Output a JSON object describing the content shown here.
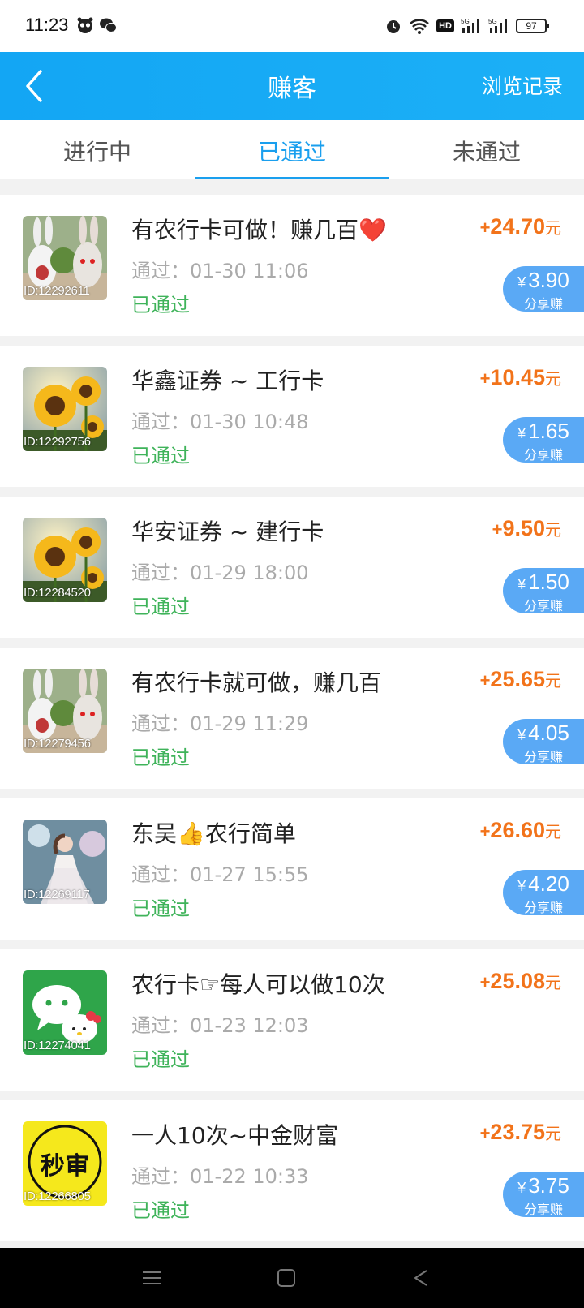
{
  "status_bar": {
    "time": "11:23",
    "hd": "HD",
    "battery": "97"
  },
  "header": {
    "title": "赚客",
    "right_action": "浏览记录"
  },
  "tabs": [
    {
      "label": "进行中"
    },
    {
      "label": "已通过",
      "active": true
    },
    {
      "label": "未通过"
    }
  ],
  "share_label": "分享赚",
  "yen": "¥",
  "items": [
    {
      "id": "ID:12292611",
      "title": "有农行卡可做！赚几百❤️",
      "time": "通过：01-30 11:06",
      "status": "已通过",
      "plus": "+",
      "amount": "24.70",
      "unit": "元",
      "share": "3.90",
      "thumb": "rabbit"
    },
    {
      "id": "ID:12292756",
      "title": "华鑫证券 ~ 工行卡",
      "time": "通过：01-30 10:48",
      "status": "已通过",
      "plus": "+",
      "amount": "10.45",
      "unit": "元",
      "share": "1.65",
      "thumb": "sunflower"
    },
    {
      "id": "ID:12284520",
      "title": "华安证券 ~ 建行卡",
      "time": "通过：01-29 18:00",
      "status": "已通过",
      "plus": "+",
      "amount": "9.50",
      "unit": "元",
      "share": "1.50",
      "thumb": "sunflower"
    },
    {
      "id": "ID:12279456",
      "title": "有农行卡就可做，赚几百",
      "time": "通过：01-29 11:29",
      "status": "已通过",
      "plus": "+",
      "amount": "25.65",
      "unit": "元",
      "share": "4.05",
      "thumb": "rabbit"
    },
    {
      "id": "ID:12269117",
      "title": "东吴👍农行简单",
      "time": "通过：01-27 15:55",
      "status": "已通过",
      "plus": "+",
      "amount": "26.60",
      "unit": "元",
      "share": "4.20",
      "thumb": "girl"
    },
    {
      "id": "ID:12274041",
      "title": "农行卡☞每人可以做10次",
      "time": "通过：01-23 12:03",
      "status": "已通过",
      "plus": "+",
      "amount": "25.08",
      "unit": "元",
      "share": null,
      "thumb": "wechat"
    },
    {
      "id": "ID:12266805",
      "title": "一人10次~中金财富",
      "time": "通过：01-22 10:33",
      "status": "已通过",
      "plus": "+",
      "amount": "23.75",
      "unit": "元",
      "share": "3.75",
      "thumb": "miaoshen",
      "thumb_text": "秒审"
    }
  ],
  "colors": {
    "header": "#13a6f4",
    "active_tab": "#1a9fee",
    "amount": "#f2731a",
    "status_green": "#3fb35a",
    "share_badge": "#5aa9f5"
  },
  "icons": {
    "back": "chevron-left-icon",
    "nav_menu": "menu-icon",
    "nav_home": "square-home-icon",
    "nav_back": "triangle-back-icon"
  }
}
